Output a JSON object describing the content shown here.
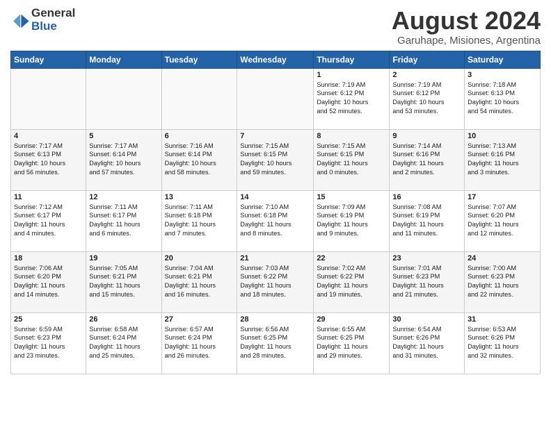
{
  "header": {
    "logo_general": "General",
    "logo_blue": "Blue",
    "main_title": "August 2024",
    "subtitle": "Garuhape, Misiones, Argentina"
  },
  "days_of_week": [
    "Sunday",
    "Monday",
    "Tuesday",
    "Wednesday",
    "Thursday",
    "Friday",
    "Saturday"
  ],
  "weeks": [
    [
      {
        "num": "",
        "info": ""
      },
      {
        "num": "",
        "info": ""
      },
      {
        "num": "",
        "info": ""
      },
      {
        "num": "",
        "info": ""
      },
      {
        "num": "1",
        "info": "Sunrise: 7:19 AM\nSunset: 6:12 PM\nDaylight: 10 hours\nand 52 minutes."
      },
      {
        "num": "2",
        "info": "Sunrise: 7:19 AM\nSunset: 6:12 PM\nDaylight: 10 hours\nand 53 minutes."
      },
      {
        "num": "3",
        "info": "Sunrise: 7:18 AM\nSunset: 6:13 PM\nDaylight: 10 hours\nand 54 minutes."
      }
    ],
    [
      {
        "num": "4",
        "info": "Sunrise: 7:17 AM\nSunset: 6:13 PM\nDaylight: 10 hours\nand 56 minutes."
      },
      {
        "num": "5",
        "info": "Sunrise: 7:17 AM\nSunset: 6:14 PM\nDaylight: 10 hours\nand 57 minutes."
      },
      {
        "num": "6",
        "info": "Sunrise: 7:16 AM\nSunset: 6:14 PM\nDaylight: 10 hours\nand 58 minutes."
      },
      {
        "num": "7",
        "info": "Sunrise: 7:15 AM\nSunset: 6:15 PM\nDaylight: 10 hours\nand 59 minutes."
      },
      {
        "num": "8",
        "info": "Sunrise: 7:15 AM\nSunset: 6:15 PM\nDaylight: 11 hours\nand 0 minutes."
      },
      {
        "num": "9",
        "info": "Sunrise: 7:14 AM\nSunset: 6:16 PM\nDaylight: 11 hours\nand 2 minutes."
      },
      {
        "num": "10",
        "info": "Sunrise: 7:13 AM\nSunset: 6:16 PM\nDaylight: 11 hours\nand 3 minutes."
      }
    ],
    [
      {
        "num": "11",
        "info": "Sunrise: 7:12 AM\nSunset: 6:17 PM\nDaylight: 11 hours\nand 4 minutes."
      },
      {
        "num": "12",
        "info": "Sunrise: 7:11 AM\nSunset: 6:17 PM\nDaylight: 11 hours\nand 6 minutes."
      },
      {
        "num": "13",
        "info": "Sunrise: 7:11 AM\nSunset: 6:18 PM\nDaylight: 11 hours\nand 7 minutes."
      },
      {
        "num": "14",
        "info": "Sunrise: 7:10 AM\nSunset: 6:18 PM\nDaylight: 11 hours\nand 8 minutes."
      },
      {
        "num": "15",
        "info": "Sunrise: 7:09 AM\nSunset: 6:19 PM\nDaylight: 11 hours\nand 9 minutes."
      },
      {
        "num": "16",
        "info": "Sunrise: 7:08 AM\nSunset: 6:19 PM\nDaylight: 11 hours\nand 11 minutes."
      },
      {
        "num": "17",
        "info": "Sunrise: 7:07 AM\nSunset: 6:20 PM\nDaylight: 11 hours\nand 12 minutes."
      }
    ],
    [
      {
        "num": "18",
        "info": "Sunrise: 7:06 AM\nSunset: 6:20 PM\nDaylight: 11 hours\nand 14 minutes."
      },
      {
        "num": "19",
        "info": "Sunrise: 7:05 AM\nSunset: 6:21 PM\nDaylight: 11 hours\nand 15 minutes."
      },
      {
        "num": "20",
        "info": "Sunrise: 7:04 AM\nSunset: 6:21 PM\nDaylight: 11 hours\nand 16 minutes."
      },
      {
        "num": "21",
        "info": "Sunrise: 7:03 AM\nSunset: 6:22 PM\nDaylight: 11 hours\nand 18 minutes."
      },
      {
        "num": "22",
        "info": "Sunrise: 7:02 AM\nSunset: 6:22 PM\nDaylight: 11 hours\nand 19 minutes."
      },
      {
        "num": "23",
        "info": "Sunrise: 7:01 AM\nSunset: 6:23 PM\nDaylight: 11 hours\nand 21 minutes."
      },
      {
        "num": "24",
        "info": "Sunrise: 7:00 AM\nSunset: 6:23 PM\nDaylight: 11 hours\nand 22 minutes."
      }
    ],
    [
      {
        "num": "25",
        "info": "Sunrise: 6:59 AM\nSunset: 6:23 PM\nDaylight: 11 hours\nand 23 minutes."
      },
      {
        "num": "26",
        "info": "Sunrise: 6:58 AM\nSunset: 6:24 PM\nDaylight: 11 hours\nand 25 minutes."
      },
      {
        "num": "27",
        "info": "Sunrise: 6:57 AM\nSunset: 6:24 PM\nDaylight: 11 hours\nand 26 minutes."
      },
      {
        "num": "28",
        "info": "Sunrise: 6:56 AM\nSunset: 6:25 PM\nDaylight: 11 hours\nand 28 minutes."
      },
      {
        "num": "29",
        "info": "Sunrise: 6:55 AM\nSunset: 6:25 PM\nDaylight: 11 hours\nand 29 minutes."
      },
      {
        "num": "30",
        "info": "Sunrise: 6:54 AM\nSunset: 6:26 PM\nDaylight: 11 hours\nand 31 minutes."
      },
      {
        "num": "31",
        "info": "Sunrise: 6:53 AM\nSunset: 6:26 PM\nDaylight: 11 hours\nand 32 minutes."
      }
    ]
  ]
}
